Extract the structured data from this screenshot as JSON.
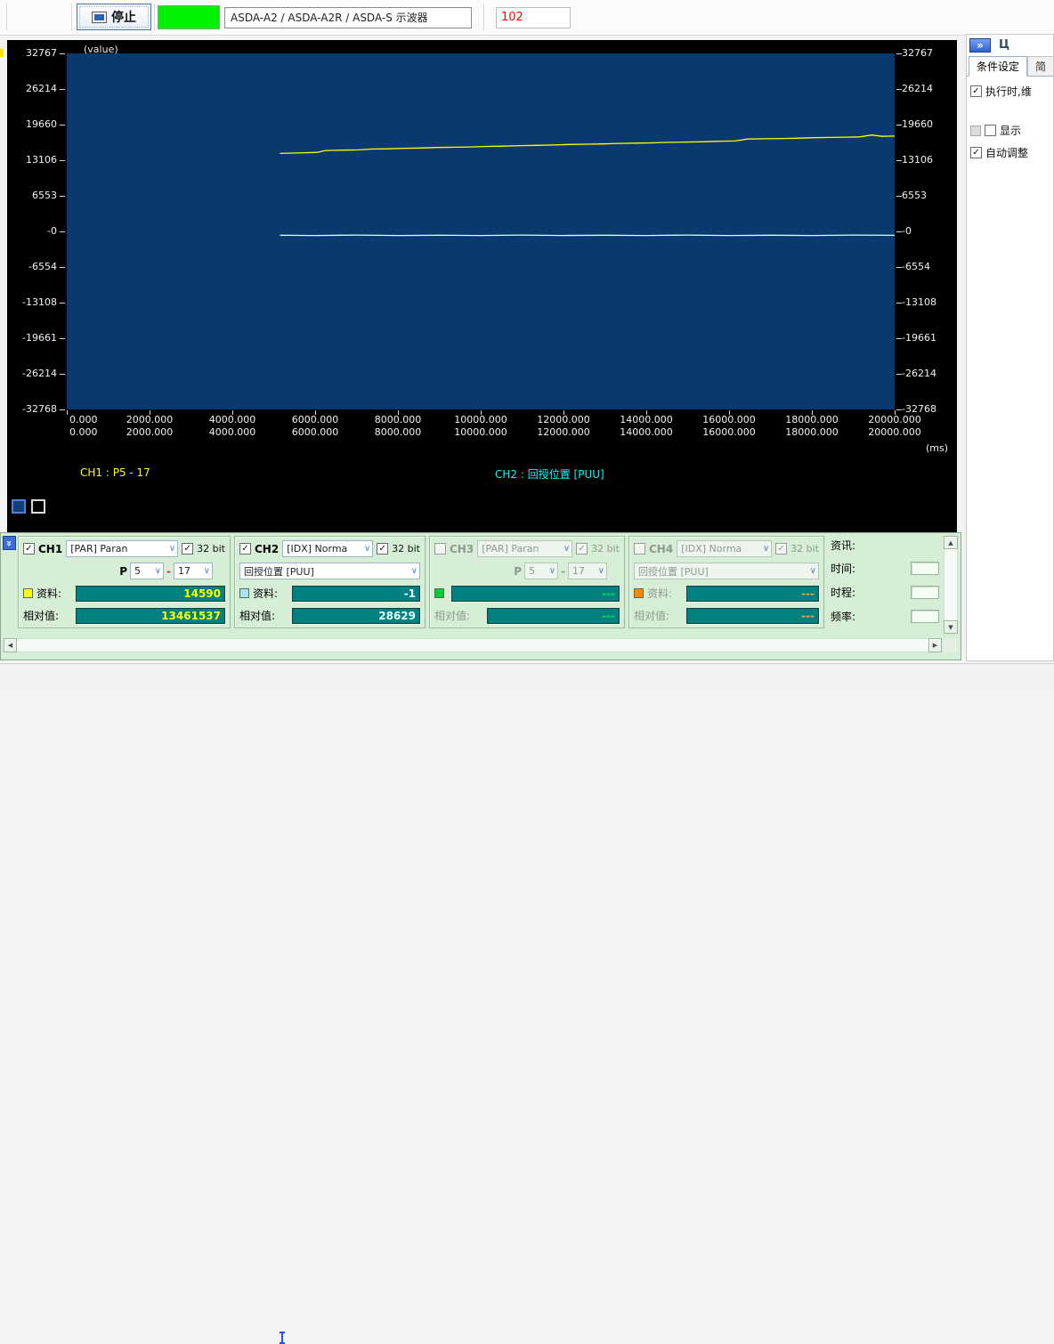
{
  "toolbar": {
    "stop_label": "停止",
    "device_label": "ASDA-A2 / ASDA-A2R / ASDA-S 示波器",
    "status_value": "102",
    "indicator_color": "#00f200"
  },
  "icons": {
    "check": "✓",
    "chevron_down": "∨",
    "expand": "»",
    "pin": "Ц",
    "arrow_up": "▲",
    "arrow_down": "▼",
    "arrow_left": "◀",
    "arrow_right": "▶"
  },
  "scope": {
    "value_label": "(value)",
    "ms_label": "(ms)",
    "y_ticks": [
      "32767",
      "26214",
      "19660",
      "13106",
      "6553",
      "-0",
      "-6554",
      "-13108",
      "-19661",
      "-26214",
      "-32768"
    ],
    "x_ticks": [
      "0.000",
      "2000.000",
      "4000.000",
      "6000.000",
      "8000.000",
      "10000.000",
      "12000.000",
      "14000.000",
      "16000.000",
      "18000.000",
      "20000.000"
    ],
    "ch1_trace_label": "CH1 : P5 - 17",
    "ch2_trace_label": "CH2 : 回授位置 [PUU]"
  },
  "chart_data": {
    "type": "line",
    "title": "",
    "xlabel": "(ms)",
    "ylabel": "(value)",
    "xlim": [
      0,
      20000
    ],
    "ylim": [
      -32768,
      32767
    ],
    "x_ticks": [
      0,
      2000,
      4000,
      6000,
      8000,
      10000,
      12000,
      14000,
      16000,
      18000,
      20000
    ],
    "y_ticks": [
      32767,
      26214,
      19660,
      13106,
      6553,
      0,
      -6554,
      -13108,
      -19661,
      -26214,
      -32768
    ],
    "grid": false,
    "plot_bg": "#0a3a6d",
    "legend_position": "below",
    "series": [
      {
        "name": "CH1 : P5 - 17",
        "color": "#ffff00",
        "points": [
          [
            5150,
            14350
          ],
          [
            5450,
            14420
          ],
          [
            5750,
            14480
          ],
          [
            6050,
            14550
          ],
          [
            6250,
            14900
          ],
          [
            6650,
            14950
          ],
          [
            7050,
            15000
          ],
          [
            7350,
            15150
          ],
          [
            7750,
            15200
          ],
          [
            8150,
            15300
          ],
          [
            8550,
            15350
          ],
          [
            8950,
            15450
          ],
          [
            9350,
            15500
          ],
          [
            9750,
            15550
          ],
          [
            10150,
            15650
          ],
          [
            10550,
            15700
          ],
          [
            10950,
            15800
          ],
          [
            11350,
            15850
          ],
          [
            11750,
            15900
          ],
          [
            12150,
            16000
          ],
          [
            12550,
            16050
          ],
          [
            12950,
            16100
          ],
          [
            13350,
            16200
          ],
          [
            13750,
            16250
          ],
          [
            14150,
            16300
          ],
          [
            14550,
            16400
          ],
          [
            14950,
            16450
          ],
          [
            15350,
            16500
          ],
          [
            15750,
            16600
          ],
          [
            16150,
            16650
          ],
          [
            16450,
            17000
          ],
          [
            16850,
            17050
          ],
          [
            17250,
            17100
          ],
          [
            17650,
            17150
          ],
          [
            18050,
            17250
          ],
          [
            18450,
            17300
          ],
          [
            18850,
            17350
          ],
          [
            19150,
            17400
          ],
          [
            19450,
            17750
          ],
          [
            19700,
            17500
          ],
          [
            20000,
            17550
          ]
        ]
      },
      {
        "name": "CH2 : 回授位置 [PUU]",
        "color": "#d4ffff",
        "points": [
          [
            5150,
            -700
          ],
          [
            6000,
            -760
          ],
          [
            7000,
            -680
          ],
          [
            8000,
            -760
          ],
          [
            9000,
            -700
          ],
          [
            10000,
            -760
          ],
          [
            11000,
            -680
          ],
          [
            12000,
            -760
          ],
          [
            13000,
            -700
          ],
          [
            14000,
            -760
          ],
          [
            15000,
            -680
          ],
          [
            16000,
            -760
          ],
          [
            17000,
            -700
          ],
          [
            18000,
            -760
          ],
          [
            19000,
            -680
          ],
          [
            20000,
            -720
          ]
        ]
      }
    ]
  },
  "channels": [
    {
      "name": "CH1",
      "enabled": true,
      "type": "[PAR] Paran",
      "bit_label": "32 bit",
      "bit_checked": true,
      "p_label": "P",
      "p_value": "5",
      "dash": "-",
      "p_sub": "17",
      "color": "#ffff00",
      "value_color": "#ffff00",
      "data_label": "资料:",
      "data_value": "14590",
      "rel_label": "相对值:",
      "rel_value": "13461537"
    },
    {
      "name": "CH2",
      "enabled": true,
      "type": "[IDX] Norma",
      "bit_label": "32 bit",
      "bit_checked": true,
      "source": "回授位置 [PUU]",
      "color": "#a8e4f4",
      "value_color": "#e8ffff",
      "data_label": "资料:",
      "data_value": "-1",
      "rel_label": "相对值:",
      "rel_value": "28629"
    },
    {
      "name": "CH3",
      "enabled": false,
      "type": "[PAR] Paran",
      "bit_label": "32 bit",
      "bit_checked": true,
      "p_label": "P",
      "p_value": "5",
      "dash": "-",
      "p_sub": "17",
      "color": "#00cc33",
      "value_color": "#00e055",
      "data_label": "",
      "data_value": "---",
      "rel_label": "相对值:",
      "rel_value": "---"
    },
    {
      "name": "CH4",
      "enabled": false,
      "type": "[IDX] Norma",
      "bit_label": "32 bit",
      "bit_checked": true,
      "source": "回授位置 [PUU]",
      "color": "#ff8800",
      "value_color": "#ffa030",
      "data_label": "资料:",
      "data_value": "---",
      "rel_label": "相对值:",
      "rel_value": "---"
    }
  ],
  "info": {
    "title": "资讯:",
    "rows": [
      {
        "label": "时间:"
      },
      {
        "label": "时程:"
      },
      {
        "label": "频率:"
      }
    ]
  },
  "right_panel": {
    "tabs": [
      {
        "label": "条件设定",
        "active": true
      },
      {
        "label": "简",
        "active": false
      }
    ],
    "run_checkbox_label": "执行时,维",
    "show_checkbox_label": "显示",
    "auto_checkbox_label": "自动调整"
  }
}
